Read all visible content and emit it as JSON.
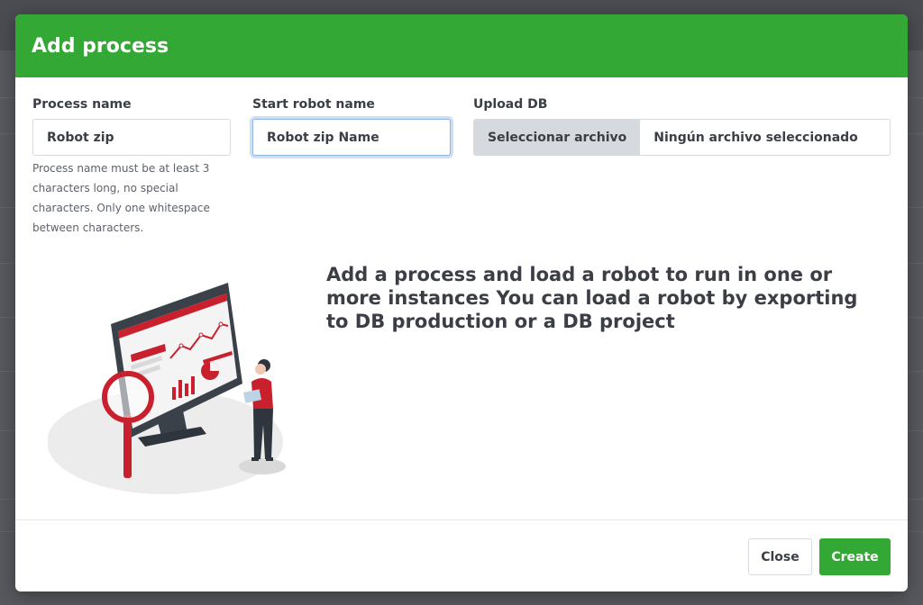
{
  "modal": {
    "title": "Add process"
  },
  "form": {
    "process_name": {
      "label": "Process name",
      "value": "Robot zip",
      "help": "Process name must be at least 3 characters long, no special characters. Only one whitespace between characters."
    },
    "start_robot_name": {
      "label": "Start robot name",
      "value": "Robot zip Name"
    },
    "upload_db": {
      "label": "Upload DB",
      "button_label": "Seleccionar archivo",
      "status": "Ningún archivo seleccionado"
    }
  },
  "description": "Add a process and load a robot to run in one or more instances You can load a robot by exporting to DB production or a DB project",
  "footer": {
    "close_label": "Close",
    "create_label": "Create"
  },
  "colors": {
    "header_green": "#34a835",
    "accent_red": "#c8202d",
    "text_dark": "#3b3f45"
  }
}
